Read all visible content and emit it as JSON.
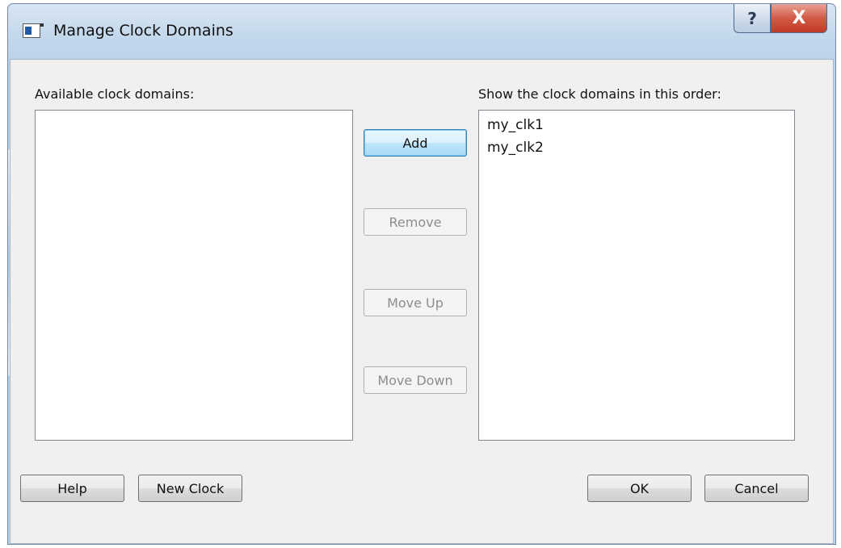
{
  "window": {
    "title": "Manage Clock Domains",
    "help_glyph": "?",
    "close_glyph": "X"
  },
  "available": {
    "label": "Available clock domains:",
    "items": []
  },
  "ordered": {
    "label": "Show the clock domains in this order:",
    "items": [
      "my_clk1",
      "my_clk2"
    ]
  },
  "middle_buttons": {
    "add": "Add",
    "remove": "Remove",
    "move_up": "Move Up",
    "move_down": "Move Down"
  },
  "footer_buttons": {
    "help": "Help",
    "new_clock": "New Clock",
    "ok": "OK",
    "cancel": "Cancel"
  },
  "icons": {
    "app": "dialog-app-icon",
    "help": "help-icon",
    "close": "close-icon"
  }
}
